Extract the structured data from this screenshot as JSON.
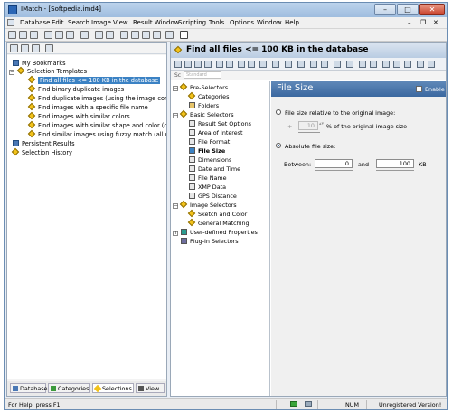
{
  "window": {
    "title": "IMatch - [Softpedia.imd4]"
  },
  "menu": [
    "Database",
    "Edit",
    "Search",
    "Image",
    "View",
    "Result Window",
    "Scripting",
    "Tools",
    "Options",
    "Window",
    "Help"
  ],
  "left_tree": {
    "items": [
      {
        "label": "My Bookmarks"
      },
      {
        "label": "Selection Templates"
      },
      {
        "label": "Find all files <= 100 KB in the database",
        "selected": true
      },
      {
        "label": "Find binary duplicate images"
      },
      {
        "label": "Find duplicate images (using the image conter"
      },
      {
        "label": "Find images with a specific file name"
      },
      {
        "label": "Find images with similar colors"
      },
      {
        "label": "Find images with similar shape and color (orier"
      },
      {
        "label": "Find similar images using fuzzy match (all orier"
      },
      {
        "label": "Persistent Results"
      },
      {
        "label": "Selection History"
      }
    ]
  },
  "left_tabs": [
    {
      "label": "Database"
    },
    {
      "label": "Categories"
    },
    {
      "label": "Selections",
      "active": true
    },
    {
      "label": "View"
    }
  ],
  "right_header": {
    "title": "Find all files <= 100 KB in the database"
  },
  "search": {
    "placeholder": "Standard"
  },
  "selectors": [
    {
      "label": "Pre-Selectors"
    },
    {
      "label": "Categories"
    },
    {
      "label": "Folders"
    },
    {
      "label": "Basic Selectors"
    },
    {
      "label": "Result Set Options"
    },
    {
      "label": "Area of Interest"
    },
    {
      "label": "File Format"
    },
    {
      "label": "File Size"
    },
    {
      "label": "Dimensions"
    },
    {
      "label": "Date and Time"
    },
    {
      "label": "File Name"
    },
    {
      "label": "XMP Data"
    },
    {
      "label": "GPS Distance"
    },
    {
      "label": "Image Selectors"
    },
    {
      "label": "Sketch and Color"
    },
    {
      "label": "General Matching"
    },
    {
      "label": "User-defined Properties"
    },
    {
      "label": "Plug-In Selectors"
    }
  ],
  "file_size": {
    "title": "File Size",
    "enable_label": "Enable",
    "enabled": true,
    "relative_label": "File size relative to the original image:",
    "plus_minus": "+ -",
    "percent_value": "10",
    "percent_suffix": "% of the original image size",
    "absolute_label": "Absolute file size:",
    "between_label": "Between:",
    "min_value": "0",
    "and_label": "and",
    "max_value": "100",
    "unit": "KB"
  },
  "status": {
    "help": "For Help, press F1",
    "num": "NUM",
    "version": "Unregistered Version!"
  }
}
